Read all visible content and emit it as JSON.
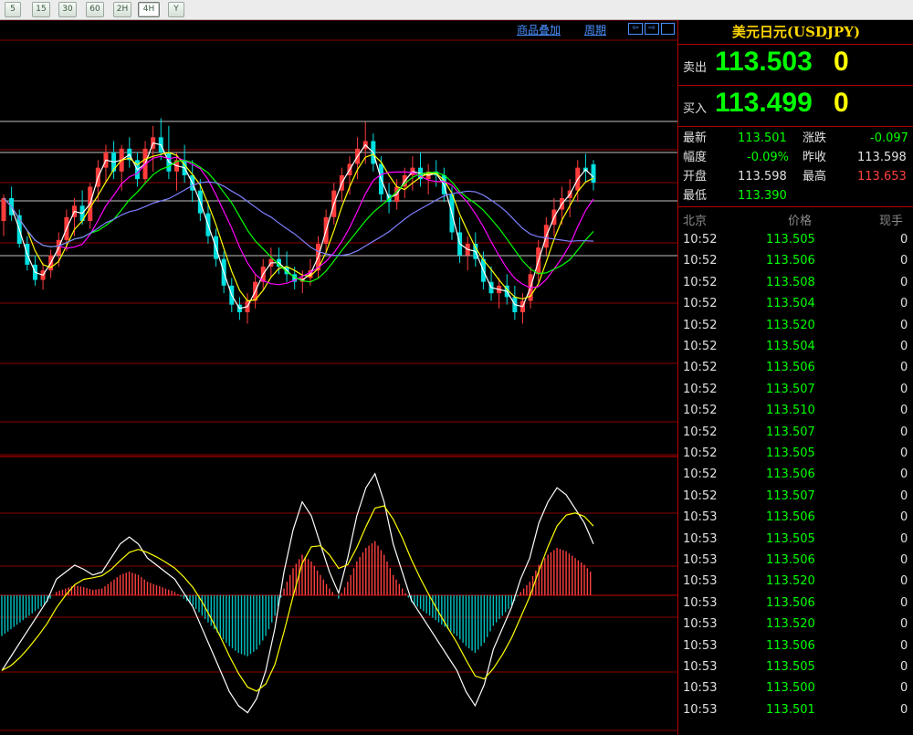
{
  "toolbar": {
    "buttons": [
      "5",
      "15",
      "30",
      "60",
      "2H",
      "4H",
      "Y"
    ],
    "active": "4H"
  },
  "chart": {
    "menu_overlay": "商品叠加",
    "menu_period": "周期",
    "nav_icons": [
      "scroll-left-icon",
      "scroll-right-icon",
      "window-icon"
    ],
    "colors": {
      "bull": "#ff3c3c",
      "bear": "#00e0e0",
      "ma1": "#ffffff",
      "ma2": "#ffff00",
      "ma3": "#ff00ff",
      "ma4": "#00ff00",
      "ma5": "#7f7fff",
      "grid": "#8b0000",
      "level": "#c0c0c0"
    }
  },
  "chart_data": {
    "type": "candlestick",
    "candles": [
      [
        113.3,
        113.44,
        113.22,
        113.42
      ],
      [
        113.42,
        113.48,
        113.3,
        113.33
      ],
      [
        113.33,
        113.36,
        113.16,
        113.18
      ],
      [
        113.18,
        113.22,
        113.04,
        113.07
      ],
      [
        113.07,
        113.12,
        112.96,
        112.99
      ],
      [
        112.99,
        113.08,
        112.94,
        113.04
      ],
      [
        113.04,
        113.15,
        113.0,
        113.12
      ],
      [
        113.12,
        113.24,
        113.06,
        113.2
      ],
      [
        113.2,
        113.36,
        113.14,
        113.32
      ],
      [
        113.32,
        113.42,
        113.22,
        113.38
      ],
      [
        113.38,
        113.46,
        113.28,
        113.3
      ],
      [
        113.3,
        113.5,
        113.26,
        113.48
      ],
      [
        113.48,
        113.62,
        113.4,
        113.58
      ],
      [
        113.58,
        113.7,
        113.5,
        113.66
      ],
      [
        113.66,
        113.72,
        113.52,
        113.56
      ],
      [
        113.56,
        113.7,
        113.46,
        113.68
      ],
      [
        113.68,
        113.74,
        113.58,
        113.62
      ],
      [
        113.62,
        113.66,
        113.48,
        113.52
      ],
      [
        113.52,
        113.72,
        113.5,
        113.68
      ],
      [
        113.68,
        113.8,
        113.56,
        113.74
      ],
      [
        113.74,
        113.84,
        113.62,
        113.66
      ],
      [
        113.66,
        113.8,
        113.52,
        113.56
      ],
      [
        113.56,
        113.66,
        113.46,
        113.62
      ],
      [
        113.62,
        113.7,
        113.5,
        113.54
      ],
      [
        113.54,
        113.62,
        113.4,
        113.46
      ],
      [
        113.46,
        113.52,
        113.3,
        113.34
      ],
      [
        113.34,
        113.4,
        113.18,
        113.22
      ],
      [
        113.22,
        113.26,
        113.06,
        113.1
      ],
      [
        113.1,
        113.14,
        112.92,
        112.96
      ],
      [
        112.96,
        113.0,
        112.82,
        112.86
      ],
      [
        112.86,
        112.9,
        112.78,
        112.82
      ],
      [
        112.82,
        112.92,
        112.76,
        112.88
      ],
      [
        112.88,
        113.02,
        112.84,
        112.98
      ],
      [
        112.98,
        113.1,
        112.94,
        113.06
      ],
      [
        113.06,
        113.16,
        113.0,
        113.1
      ],
      [
        113.1,
        113.16,
        113.02,
        113.06
      ],
      [
        113.06,
        113.14,
        112.98,
        113.02
      ],
      [
        113.02,
        113.06,
        112.94,
        112.98
      ],
      [
        112.98,
        113.04,
        112.92,
        113.0
      ],
      [
        113.0,
        113.1,
        112.96,
        113.04
      ],
      [
        113.04,
        113.22,
        113.0,
        113.18
      ],
      [
        113.18,
        113.36,
        113.14,
        113.32
      ],
      [
        113.32,
        113.5,
        113.28,
        113.46
      ],
      [
        113.46,
        113.58,
        113.4,
        113.54
      ],
      [
        113.54,
        113.64,
        113.44,
        113.6
      ],
      [
        113.6,
        113.74,
        113.52,
        113.68
      ],
      [
        113.68,
        113.82,
        113.6,
        113.72
      ],
      [
        113.72,
        113.76,
        113.56,
        113.6
      ],
      [
        113.6,
        113.64,
        113.4,
        113.44
      ],
      [
        113.44,
        113.5,
        113.34,
        113.4
      ],
      [
        113.4,
        113.52,
        113.36,
        113.48
      ],
      [
        113.48,
        113.58,
        113.42,
        113.54
      ],
      [
        113.54,
        113.64,
        113.46,
        113.58
      ],
      [
        113.58,
        113.66,
        113.48,
        113.52
      ],
      [
        113.52,
        113.6,
        113.44,
        113.56
      ],
      [
        113.56,
        113.62,
        113.48,
        113.54
      ],
      [
        113.54,
        113.58,
        113.4,
        113.44
      ],
      [
        113.44,
        113.48,
        113.2,
        113.24
      ],
      [
        113.24,
        113.32,
        113.08,
        113.12
      ],
      [
        113.12,
        113.22,
        113.04,
        113.18
      ],
      [
        113.18,
        113.24,
        113.06,
        113.1
      ],
      [
        113.1,
        113.14,
        112.94,
        112.98
      ],
      [
        112.98,
        113.06,
        112.88,
        112.92
      ],
      [
        112.92,
        113.0,
        112.84,
        112.96
      ],
      [
        112.96,
        113.02,
        112.86,
        112.9
      ],
      [
        112.9,
        112.96,
        112.78,
        112.82
      ],
      [
        112.82,
        112.92,
        112.76,
        112.88
      ],
      [
        112.88,
        113.06,
        112.84,
        113.02
      ],
      [
        113.02,
        113.2,
        112.98,
        113.16
      ],
      [
        113.16,
        113.32,
        113.12,
        113.28
      ],
      [
        113.28,
        113.42,
        113.22,
        113.36
      ],
      [
        113.36,
        113.48,
        113.28,
        113.42
      ],
      [
        113.42,
        113.52,
        113.32,
        113.46
      ],
      [
        113.46,
        113.62,
        113.4,
        113.58
      ],
      [
        113.58,
        113.653,
        113.5,
        113.56
      ],
      [
        113.598,
        113.62,
        113.46,
        113.501
      ]
    ],
    "macd": [
      -0.6,
      -0.5,
      -0.4,
      -0.3,
      -0.2,
      -0.1,
      0.05,
      0.1,
      0.15,
      0.12,
      0.08,
      0.1,
      0.2,
      0.3,
      0.35,
      0.3,
      0.2,
      0.15,
      0.1,
      0.05,
      -0.05,
      -0.15,
      -0.3,
      -0.45,
      -0.6,
      -0.75,
      -0.85,
      -0.9,
      -0.8,
      -0.6,
      -0.3,
      0.1,
      0.4,
      0.6,
      0.5,
      0.3,
      0.1,
      -0.05,
      0.2,
      0.5,
      0.7,
      0.8,
      0.6,
      0.3,
      0.1,
      -0.1,
      -0.2,
      -0.3,
      -0.4,
      -0.5,
      -0.6,
      -0.75,
      -0.85,
      -0.7,
      -0.45,
      -0.3,
      -0.15,
      0.05,
      0.2,
      0.45,
      0.6,
      0.7,
      0.65,
      0.55,
      0.45,
      0.3
    ]
  },
  "panel": {
    "symbol": "美元日元(USDJPY)",
    "sell_label": "卖出",
    "sell_price": "113.503",
    "sell_vol": "0",
    "buy_label": "买入",
    "buy_price": "113.499",
    "buy_vol": "0",
    "stats": {
      "last_label": "最新",
      "last": "113.501",
      "chg_label": "涨跌",
      "chg": "-0.097",
      "range_label": "幅度",
      "range": "-0.09%",
      "prev_label": "昨收",
      "prev": "113.598",
      "open_label": "开盘",
      "open": "113.598",
      "high_label": "最高",
      "high": "113.653",
      "low_label": "最低",
      "low": "113.390"
    },
    "ticks_header": [
      "北京",
      "价格",
      "现手"
    ],
    "ticks": [
      {
        "time": "10:52",
        "price": "113.505",
        "vol": "0"
      },
      {
        "time": "10:52",
        "price": "113.506",
        "vol": "0"
      },
      {
        "time": "10:52",
        "price": "113.508",
        "vol": "0"
      },
      {
        "time": "10:52",
        "price": "113.504",
        "vol": "0"
      },
      {
        "time": "10:52",
        "price": "113.520",
        "vol": "0"
      },
      {
        "time": "10:52",
        "price": "113.504",
        "vol": "0"
      },
      {
        "time": "10:52",
        "price": "113.506",
        "vol": "0"
      },
      {
        "time": "10:52",
        "price": "113.507",
        "vol": "0"
      },
      {
        "time": "10:52",
        "price": "113.510",
        "vol": "0"
      },
      {
        "time": "10:52",
        "price": "113.507",
        "vol": "0"
      },
      {
        "time": "10:52",
        "price": "113.505",
        "vol": "0"
      },
      {
        "time": "10:52",
        "price": "113.506",
        "vol": "0"
      },
      {
        "time": "10:52",
        "price": "113.507",
        "vol": "0"
      },
      {
        "time": "10:53",
        "price": "113.506",
        "vol": "0"
      },
      {
        "time": "10:53",
        "price": "113.505",
        "vol": "0"
      },
      {
        "time": "10:53",
        "price": "113.506",
        "vol": "0"
      },
      {
        "time": "10:53",
        "price": "113.520",
        "vol": "0"
      },
      {
        "time": "10:53",
        "price": "113.506",
        "vol": "0"
      },
      {
        "time": "10:53",
        "price": "113.520",
        "vol": "0"
      },
      {
        "time": "10:53",
        "price": "113.506",
        "vol": "0"
      },
      {
        "time": "10:53",
        "price": "113.505",
        "vol": "0"
      },
      {
        "time": "10:53",
        "price": "113.500",
        "vol": "0"
      },
      {
        "time": "10:53",
        "price": "113.501",
        "vol": "0"
      }
    ]
  }
}
